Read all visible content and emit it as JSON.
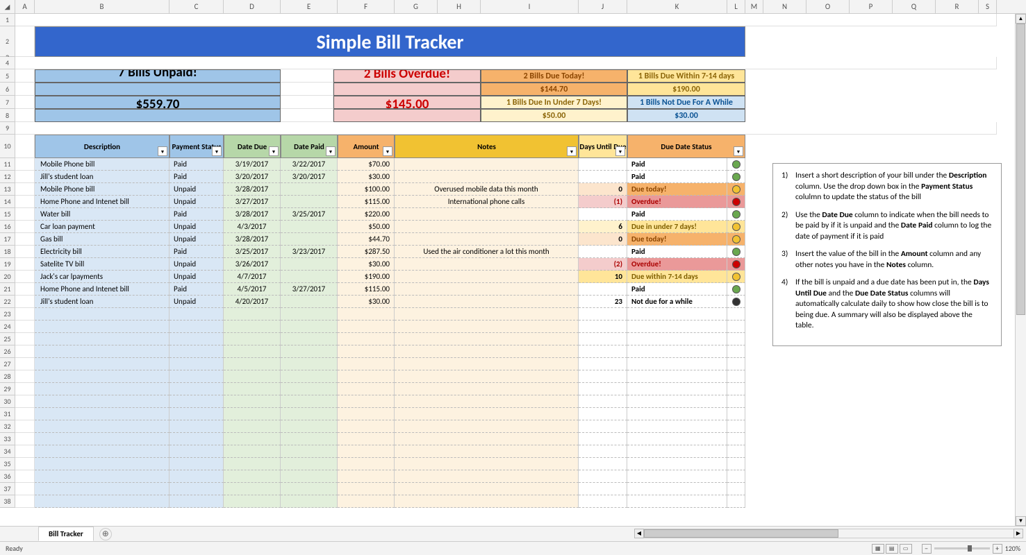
{
  "columns": [
    {
      "letter": "A",
      "w": 28
    },
    {
      "letter": "B",
      "w": 194
    },
    {
      "letter": "C",
      "w": 78
    },
    {
      "letter": "D",
      "w": 82
    },
    {
      "letter": "E",
      "w": 82
    },
    {
      "letter": "F",
      "w": 82
    },
    {
      "letter": "G",
      "w": 62
    },
    {
      "letter": "H",
      "w": 62
    },
    {
      "letter": "I",
      "w": 141
    },
    {
      "letter": "J",
      "w": 70
    },
    {
      "letter": "K",
      "w": 144
    },
    {
      "letter": "L",
      "w": 26
    },
    {
      "letter": "M",
      "w": 26
    },
    {
      "letter": "N",
      "w": 62
    },
    {
      "letter": "O",
      "w": 62
    },
    {
      "letter": "P",
      "w": 62
    },
    {
      "letter": "Q",
      "w": 62
    },
    {
      "letter": "R",
      "w": 62
    },
    {
      "letter": "S",
      "w": 26
    }
  ],
  "title": "Simple Bill Tracker",
  "summary": {
    "unpaid_title": "7 Bills Unpaid!",
    "unpaid_amount": "$559.70",
    "overdue_title": "2 Bills Overdue!",
    "overdue_amount": "$145.00",
    "today_title": "2 Bills Due Today!",
    "today_amount": "$144.70",
    "d714_title": "1 Bills Due Within 7-14 days",
    "d714_amount": "$190.00",
    "u7_title": "1 Bills Due In Under 7 Days!",
    "u7_amount": "$50.00",
    "notwhile_title": "1 Bills Not Due For A While",
    "notwhile_amount": "$30.00"
  },
  "headers": {
    "description": "Description",
    "status": "Payment Status",
    "date_due": "Date Due",
    "date_paid": "Date Paid",
    "amount": "Amount",
    "notes": "Notes",
    "days_until": "Days Until Due",
    "due_date_status": "Due Date Status"
  },
  "rows": [
    {
      "desc": "Mobile Phone bill",
      "status": "Paid",
      "due": "3/19/2017",
      "paid": "3/22/2017",
      "amt": "$70.00",
      "notes": "",
      "days": "",
      "dcls": "",
      "dds": "Paid",
      "dclass": "",
      "dot": "green"
    },
    {
      "desc": "Jill's student loan",
      "status": "Paid",
      "due": "3/20/2017",
      "paid": "3/20/2017",
      "amt": "$30.00",
      "notes": "",
      "days": "",
      "dcls": "",
      "dds": "Paid",
      "dclass": "",
      "dot": "green"
    },
    {
      "desc": "Mobile Phone bill",
      "status": "Unpaid",
      "due": "3/28/2017",
      "paid": "",
      "amt": "$100.00",
      "notes": "Overused mobile data this month",
      "days": "0",
      "dcls": "days-today",
      "dds": "Due today!",
      "dclass": "dds-today",
      "dot": "amber"
    },
    {
      "desc": "Home Phone and Intenet bill",
      "status": "Unpaid",
      "due": "3/27/2017",
      "paid": "",
      "amt": "$115.00",
      "notes": "International phone calls",
      "days": "(1)",
      "dcls": "days-overdue",
      "dds": "Overdue!",
      "dclass": "dds-overdue",
      "dot": "red"
    },
    {
      "desc": "Water bill",
      "status": "Paid",
      "due": "3/28/2017",
      "paid": "3/25/2017",
      "amt": "$220.00",
      "notes": "",
      "days": "",
      "dcls": "",
      "dds": "Paid",
      "dclass": "",
      "dot": "green"
    },
    {
      "desc": "Car loan payment",
      "status": "Unpaid",
      "due": "4/3/2017",
      "paid": "",
      "amt": "$50.00",
      "notes": "",
      "days": "6",
      "dcls": "days-u7",
      "dds": "Due in under 7 days!",
      "dclass": "dds-u7",
      "dot": "amber"
    },
    {
      "desc": "Gas bill",
      "status": "Unpaid",
      "due": "3/28/2017",
      "paid": "",
      "amt": "$44.70",
      "notes": "",
      "days": "0",
      "dcls": "days-today",
      "dds": "Due today!",
      "dclass": "dds-today",
      "dot": "amber"
    },
    {
      "desc": "Electricity bill",
      "status": "Paid",
      "due": "3/25/2017",
      "paid": "3/23/2017",
      "amt": "$287.50",
      "notes": "Used the air conditioner a lot this month",
      "days": "",
      "dcls": "",
      "dds": "Paid",
      "dclass": "",
      "dot": "green"
    },
    {
      "desc": "Satelite TV bill",
      "status": "Unpaid",
      "due": "3/26/2017",
      "paid": "",
      "amt": "$30.00",
      "notes": "",
      "days": "(2)",
      "dcls": "days-overdue",
      "dds": "Overdue!",
      "dclass": "dds-overdue",
      "dot": "red"
    },
    {
      "desc": "Jack's car lpayments",
      "status": "Unpaid",
      "due": "4/7/2017",
      "paid": "",
      "amt": "$190.00",
      "notes": "",
      "days": "10",
      "dcls": "days-714",
      "dds": "Due within 7-14 days",
      "dclass": "dds-714",
      "dot": "amber"
    },
    {
      "desc": "Home Phone and Intenet bill",
      "status": "Paid",
      "due": "4/5/2017",
      "paid": "3/27/2017",
      "amt": "$115.00",
      "notes": "",
      "days": "",
      "dcls": "",
      "dds": "Paid",
      "dclass": "",
      "dot": "green"
    },
    {
      "desc": "Jill's student loan",
      "status": "Unpaid",
      "due": "4/20/2017",
      "paid": "",
      "amt": "$30.00",
      "notes": "",
      "days": "23",
      "dcls": "",
      "dds": "Not due for a while",
      "dclass": "",
      "dot": "black"
    }
  ],
  "instructions": [
    {
      "n": "1)",
      "pre": "Insert a short description of your bill  under the ",
      "b1": "Description",
      "mid": " column. Use the drop down box in the ",
      "b2": "Payment Status",
      "post": " colulmn to update the status of the bill"
    },
    {
      "n": "2)",
      "pre": "Use the ",
      "b1": "Date Due",
      "mid": "  column to indicate when the bill needs to be paid by if it is unpaid and the ",
      "b2": "Date Paid",
      "post": " column to log the date of payment if it is paid"
    },
    {
      "n": "3)",
      "pre": "Insert the value of the bill in the ",
      "b1": "Amount",
      "mid": " column and any other notes you have in the ",
      "b2": "Notes",
      "post": " column."
    },
    {
      "n": "4)",
      "pre": "If the bill is unpaid and a due date has been put in, the ",
      "b1": "Days Until Due",
      "mid": " and the ",
      "b2": "Due Date Status",
      "post": " columns will automatically calculate daily to show how close the bill is to being due. A summary will also be displayed above the table."
    }
  ],
  "sheet_tab": "Bill Tracker",
  "status_text": "Ready",
  "zoom": "120%"
}
